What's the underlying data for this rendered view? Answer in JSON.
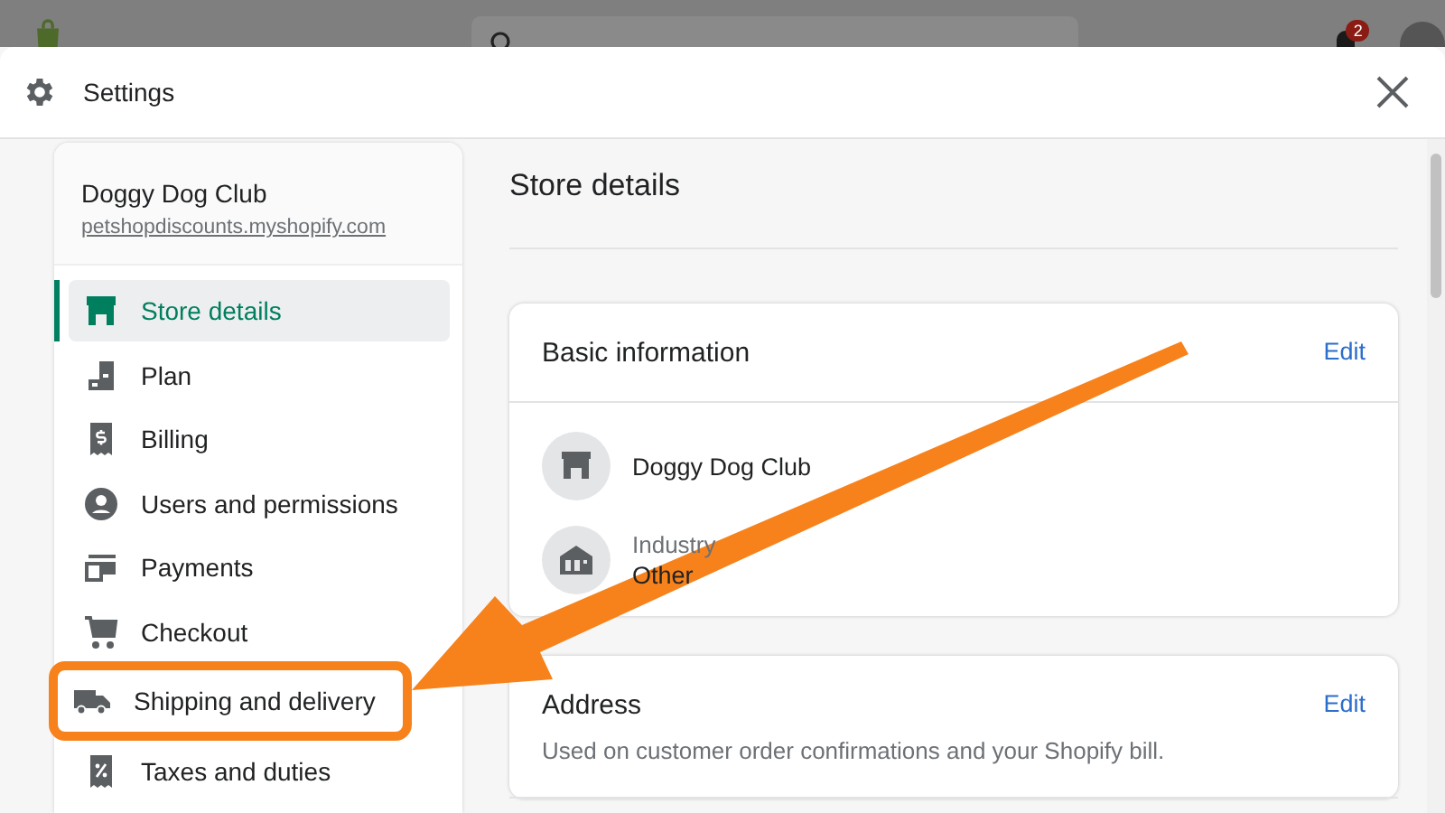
{
  "topbar": {
    "notifications": "2"
  },
  "window": {
    "title": "Settings"
  },
  "sidebar": {
    "store_name": "Doggy Dog Club",
    "store_url": "petshopdiscounts.myshopify.com",
    "items": [
      {
        "label": "Store details",
        "selected": true,
        "highlighted": false
      },
      {
        "label": "Plan",
        "selected": false,
        "highlighted": false
      },
      {
        "label": "Billing",
        "selected": false,
        "highlighted": false
      },
      {
        "label": "Users and permissions",
        "selected": false,
        "highlighted": false
      },
      {
        "label": "Payments",
        "selected": false,
        "highlighted": false
      },
      {
        "label": "Checkout",
        "selected": false,
        "highlighted": false
      },
      {
        "label": "Shipping and delivery",
        "selected": false,
        "highlighted": true
      },
      {
        "label": "Taxes and duties",
        "selected": false,
        "highlighted": false
      }
    ]
  },
  "main": {
    "title": "Store details",
    "cards": [
      {
        "title": "Basic information",
        "action": "Edit",
        "rows": [
          {
            "kind": "store",
            "value": "Doggy Dog Club"
          },
          {
            "kind": "industry",
            "label": "Industry",
            "value": "Other"
          }
        ]
      },
      {
        "title": "Address",
        "action": "Edit",
        "description": "Used on customer order confirmations and your Shopify bill."
      }
    ]
  }
}
